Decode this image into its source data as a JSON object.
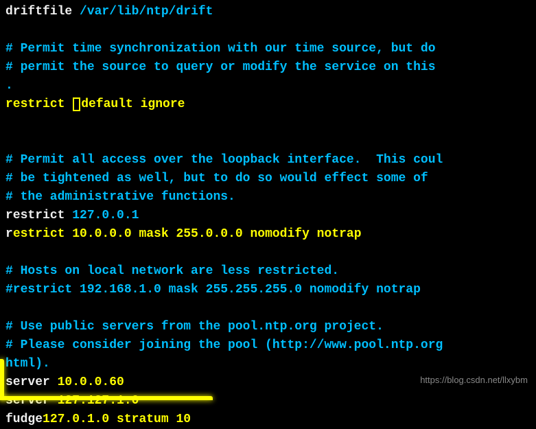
{
  "lines": {
    "l1_a": "driftfile ",
    "l1_b": "/var/lib/ntp/drift",
    "l2": "",
    "l3": "# Permit time synchronization with our time source, but do",
    "l4": "# permit the source to query or modify the service on this",
    "l5": ".",
    "l6_a": "restrict ",
    "l6_b": "default ignore",
    "l7": "",
    "l8": "",
    "l9": "# Permit all access over the loopback interface.  This coul",
    "l10": "# be tightened as well, but to do so would effect some of",
    "l11": "# the administrative functions.",
    "l12_a": "restrict ",
    "l12_b": "127.0.0.1",
    "l13_a": "r",
    "l13_b": "estrict 10.0.0.0 mask 255.0.0.0 nomodify notrap",
    "l14": "",
    "l15": "# Hosts on local network are less restricted.",
    "l16": "#restrict 192.168.1.0 mask 255.255.255.0 nomodify notrap",
    "l17": "",
    "l18": "# Use public servers from the pool.ntp.org project.",
    "l19": "# Please consider joining the pool (http://www.pool.ntp.org",
    "l20": "html).",
    "l21_a": "server ",
    "l21_b": "10.0.0.60",
    "l22_a": "server ",
    "l22_b": "127.127.1.0",
    "l23_a": "fudge",
    "l23_b": "127.0.1.0 stratum 10"
  },
  "watermark": "https://blog.csdn.net/llxybm"
}
